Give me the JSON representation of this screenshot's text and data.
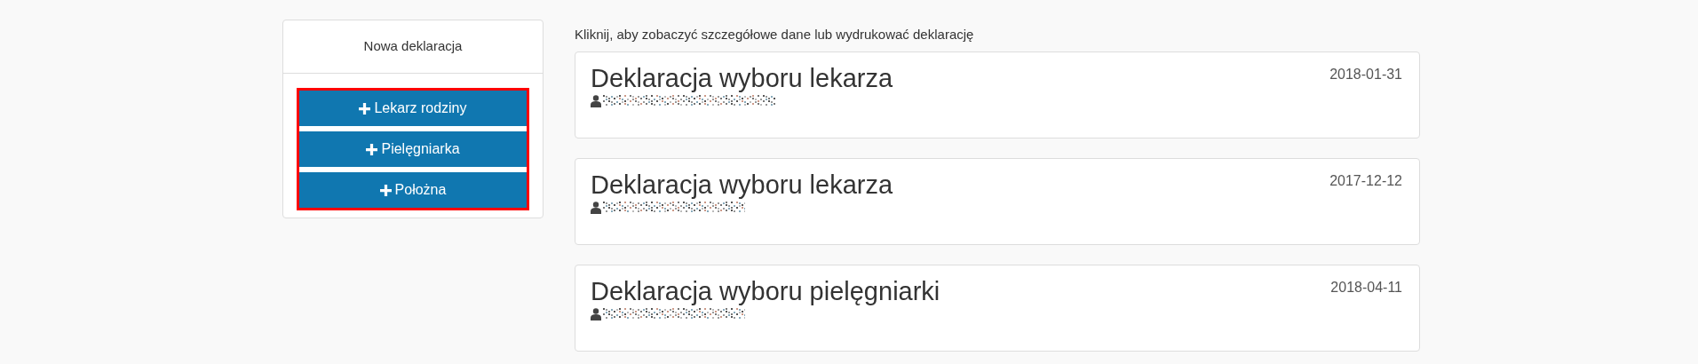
{
  "new_declaration_panel": {
    "title": "Nowa deklaracja",
    "buttons": [
      {
        "label": "Lekarz rodziny"
      },
      {
        "label": "Pielęgniarka"
      },
      {
        "label": "Położna"
      }
    ]
  },
  "hint": "Kliknij, aby zobaczyć szczegółowe dane lub wydrukować deklarację",
  "declarations": [
    {
      "title": "Deklaracja wyboru lekarza",
      "date": "2018-01-31"
    },
    {
      "title": "Deklaracja wyboru lekarza",
      "date": "2017-12-12"
    },
    {
      "title": "Deklaracja wyboru pielęgniarki",
      "date": "2018-04-11"
    }
  ]
}
